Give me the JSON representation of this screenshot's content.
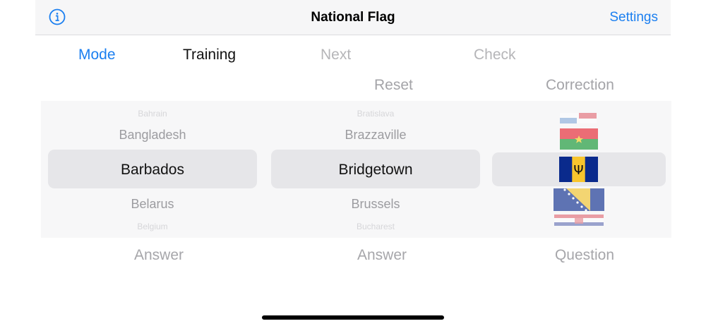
{
  "navbar": {
    "title": "National Flag",
    "settings_label": "Settings",
    "info_icon": "info-circle-icon"
  },
  "controls": {
    "mode_label": "Mode",
    "training_label": "Training",
    "next_label": "Next",
    "check_label": "Check",
    "reset_label": "Reset",
    "correction_label": "Correction"
  },
  "pickers": {
    "country": {
      "items": [
        "Bahrain",
        "Bangladesh",
        "Barbados",
        "Belarus",
        "Belgium"
      ],
      "label": "Answer"
    },
    "capital": {
      "items": [
        "Bratislava",
        "Brazzaville",
        "Bridgetown",
        "Brussels",
        "Bucharest"
      ],
      "label": "Answer"
    },
    "flag": {
      "items": [
        "flag-bahrain",
        "flag-burkina-faso",
        "flag-barbados",
        "flag-bosnia",
        "flag-croatia"
      ],
      "label": "Question"
    }
  },
  "colors": {
    "accent": "#1b7ff0",
    "disabled": "#b5b5b8"
  }
}
